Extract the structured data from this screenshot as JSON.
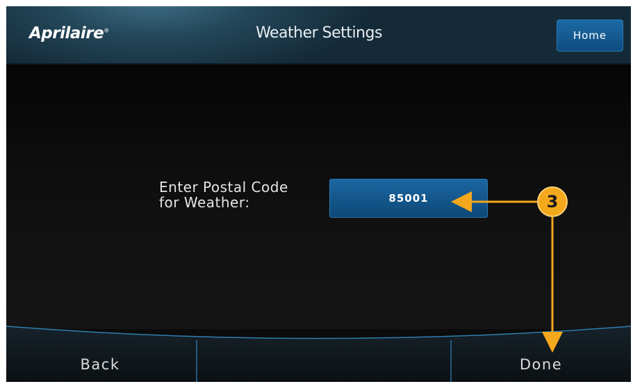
{
  "header": {
    "logo": "Aprilaire",
    "logo_mark": "®",
    "title": "Weather Settings",
    "home_label": "Home"
  },
  "main": {
    "postal_label_line1": "Enter Postal Code",
    "postal_label_line2": "for Weather:",
    "postal_code_value": "85001"
  },
  "footer": {
    "back_label": "Back",
    "done_label": "Done"
  },
  "annotation": {
    "step_number": "3",
    "color": "#f4a81c"
  },
  "colors": {
    "header_bg": "#1f3d50",
    "button_blue": "#14598f",
    "screen_bg": "#0b0b0b",
    "accent_line": "#2a6f9a"
  }
}
